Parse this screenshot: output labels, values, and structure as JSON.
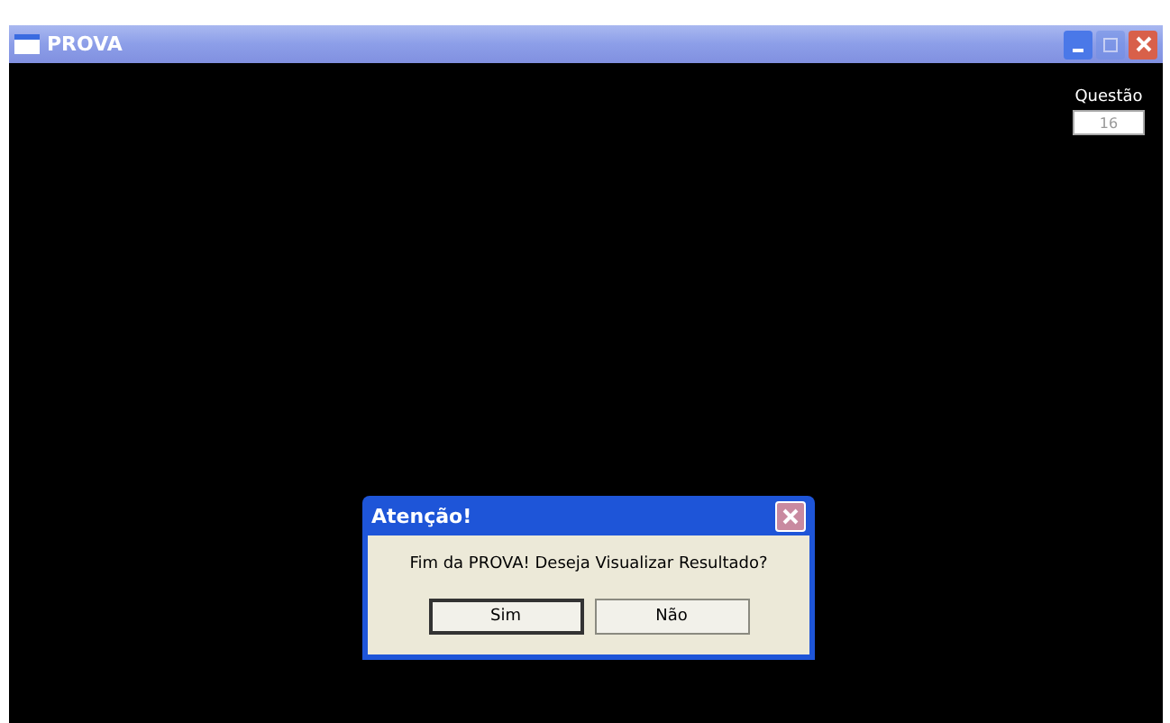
{
  "window": {
    "title": "PROVA",
    "buttons": [
      {
        "kind": "minimize",
        "disabled": false
      },
      {
        "kind": "maximize",
        "disabled": true
      },
      {
        "kind": "close",
        "disabled": false
      }
    ]
  },
  "question": {
    "label": "Questão",
    "value": "16"
  },
  "dialog": {
    "title": "Atenção!",
    "message": "Fim da PROVA! Deseja Visualizar Resultado?",
    "close_disabled": true,
    "buttons": [
      {
        "label": "Sim",
        "focused": true
      },
      {
        "label": "Não",
        "focused": false
      }
    ]
  }
}
